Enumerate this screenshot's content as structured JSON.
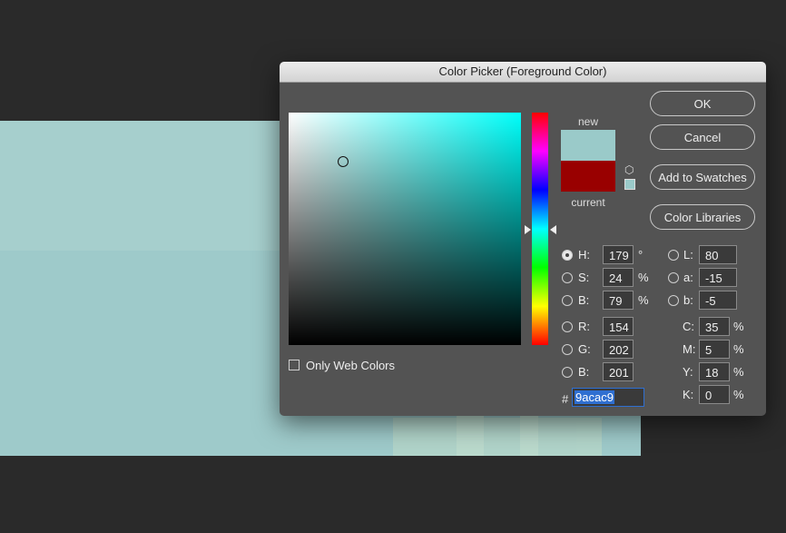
{
  "dialog": {
    "title": "Color Picker (Foreground Color)"
  },
  "colors": {
    "new": "#9acac9",
    "current": "#990000"
  },
  "preview": {
    "new_label": "new",
    "current_label": "current"
  },
  "buttons": {
    "ok": "OK",
    "cancel": "Cancel",
    "add_to_swatches": "Add to Swatches",
    "color_libraries": "Color Libraries"
  },
  "hsb": [
    {
      "key": "H",
      "label": "H:",
      "value": "179",
      "unit": "°",
      "checked": true
    },
    {
      "key": "S",
      "label": "S:",
      "value": "24",
      "unit": "%",
      "checked": false
    },
    {
      "key": "B",
      "label": "B:",
      "value": "79",
      "unit": "%",
      "checked": false
    }
  ],
  "rgb": [
    {
      "key": "R",
      "label": "R:",
      "value": "154"
    },
    {
      "key": "G",
      "label": "G:",
      "value": "202"
    },
    {
      "key": "B",
      "label": "B:",
      "value": "201"
    }
  ],
  "lab": [
    {
      "key": "L",
      "label": "L:",
      "value": "80"
    },
    {
      "key": "a",
      "label": "a:",
      "value": "-15"
    },
    {
      "key": "b",
      "label": "b:",
      "value": "-5"
    }
  ],
  "cmyk": [
    {
      "key": "C",
      "label": "C:",
      "value": "35",
      "unit": "%"
    },
    {
      "key": "M",
      "label": "M:",
      "value": "5",
      "unit": "%"
    },
    {
      "key": "Y",
      "label": "Y:",
      "value": "18",
      "unit": "%"
    },
    {
      "key": "K",
      "label": "K:",
      "value": "0",
      "unit": "%"
    }
  ],
  "hex": {
    "symbol": "#",
    "value": "9acac9"
  },
  "web_colors": {
    "label": "Only Web Colors",
    "checked": false
  },
  "icons": {
    "gamut": "cube-icon"
  }
}
